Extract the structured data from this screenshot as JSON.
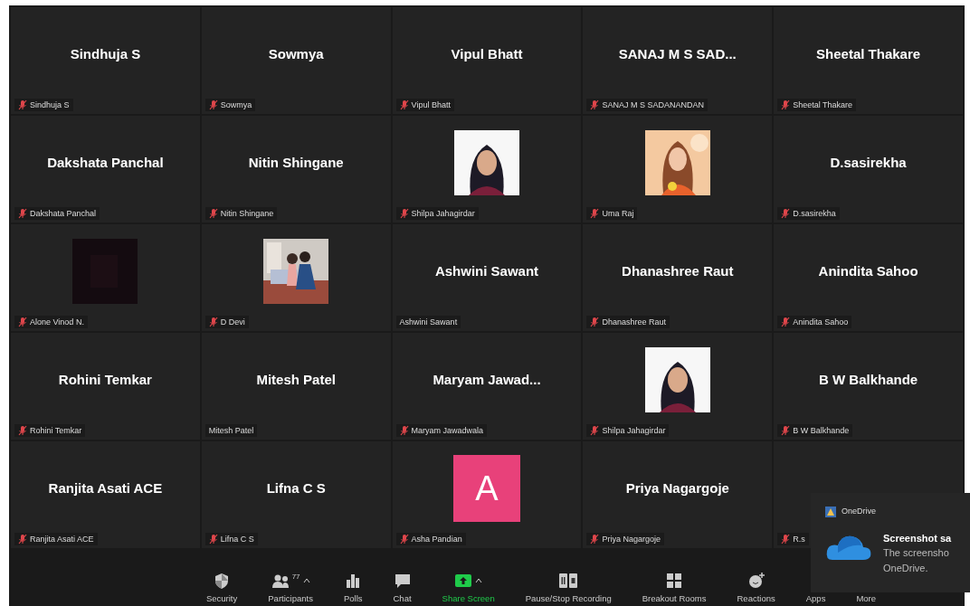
{
  "tiles": [
    {
      "kind": "name",
      "display_name": "Sindhuja S",
      "label": "Sindhuja S",
      "muted": true
    },
    {
      "kind": "name",
      "display_name": "Sowmya",
      "label": "Sowmya",
      "muted": true
    },
    {
      "kind": "name",
      "display_name": "Vipul Bhatt",
      "label": "Vipul Bhatt",
      "muted": true
    },
    {
      "kind": "name",
      "display_name": "SANAJ M S SAD...",
      "label": "SANAJ M S SADANANDAN",
      "muted": true
    },
    {
      "kind": "name",
      "display_name": "Sheetal Thakare",
      "label": "Sheetal Thakare",
      "muted": true
    },
    {
      "kind": "name",
      "display_name": "Dakshata Panchal",
      "label": "Dakshata Panchal",
      "muted": true
    },
    {
      "kind": "name",
      "display_name": "Nitin Shingane",
      "label": "Nitin Shingane",
      "muted": true
    },
    {
      "label": "Shilpa Jahagirdar",
      "muted": true
    },
    {
      "label": "Uma Raj",
      "muted": true
    },
    {
      "kind": "name",
      "display_name": "D.sasirekha",
      "label": "D.sasirekha",
      "muted": true
    },
    {
      "label": "Alone Vinod N.",
      "muted": true
    },
    {
      "label": "D Devi",
      "muted": true
    },
    {
      "kind": "name",
      "display_name": "Ashwini Sawant",
      "label": "Ashwini Sawant",
      "muted": false
    },
    {
      "kind": "name",
      "display_name": "Dhanashree Raut",
      "label": "Dhanashree Raut",
      "muted": true
    },
    {
      "kind": "name",
      "display_name": "Anindita Sahoo",
      "label": "Anindita Sahoo",
      "muted": true
    },
    {
      "kind": "name",
      "display_name": "Rohini Temkar",
      "label": "Rohini Temkar",
      "muted": true
    },
    {
      "kind": "name",
      "display_name": "Mitesh Patel",
      "label": "Mitesh Patel",
      "muted": false
    },
    {
      "kind": "name",
      "display_name": "Maryam  Jawad...",
      "label": "Maryam Jawadwala",
      "muted": true
    },
    {
      "label": "Shilpa Jahagirdar",
      "muted": true
    },
    {
      "kind": "name",
      "display_name": "B W Balkhande",
      "label": "B W Balkhande",
      "muted": true
    },
    {
      "kind": "name",
      "display_name": "Ranjita Asati ACE",
      "label": "Ranjita Asati ACE",
      "muted": true
    },
    {
      "kind": "name",
      "display_name": "Lifna C S",
      "label": "Lifna C S",
      "muted": true
    },
    {
      "kind": "avatar",
      "letter": "A",
      "color": "#e8417a",
      "label": "Asha Pandian",
      "muted": true
    },
    {
      "kind": "name",
      "display_name": "Priya Nagargoje",
      "label": "Priya Nagargoje",
      "muted": true
    },
    {
      "kind": "name",
      "label": "R.s",
      "muted": true
    }
  ],
  "toolbar": [
    {
      "kind": "security",
      "label": "Security",
      "highlighted": false,
      "has_menu": false
    },
    {
      "kind": "participants",
      "label": "Participants",
      "count": "77",
      "highlighted": false,
      "has_menu": true
    },
    {
      "kind": "polls",
      "label": "Polls",
      "highlighted": false,
      "has_menu": false
    },
    {
      "kind": "chat",
      "label": "Chat",
      "highlighted": false,
      "has_menu": false
    },
    {
      "kind": "share",
      "label": "Share Screen",
      "highlighted": true,
      "has_menu": true
    },
    {
      "kind": "recording",
      "label": "Pause/Stop Recording",
      "highlighted": false,
      "has_menu": false
    },
    {
      "kind": "breakout",
      "label": "Breakout Rooms",
      "highlighted": false,
      "has_menu": false
    },
    {
      "kind": "reactions",
      "label": "Reactions",
      "highlighted": false,
      "has_menu": false
    },
    {
      "kind": "apps",
      "label": "Apps",
      "highlighted": false,
      "has_menu": false
    },
    {
      "kind": "more",
      "label": "More",
      "highlighted": false,
      "has_menu": false
    }
  ],
  "notification": {
    "app": "OneDrive",
    "title": "Screenshot sa",
    "body_lines": [
      "The screensho",
      "OneDrive."
    ]
  }
}
